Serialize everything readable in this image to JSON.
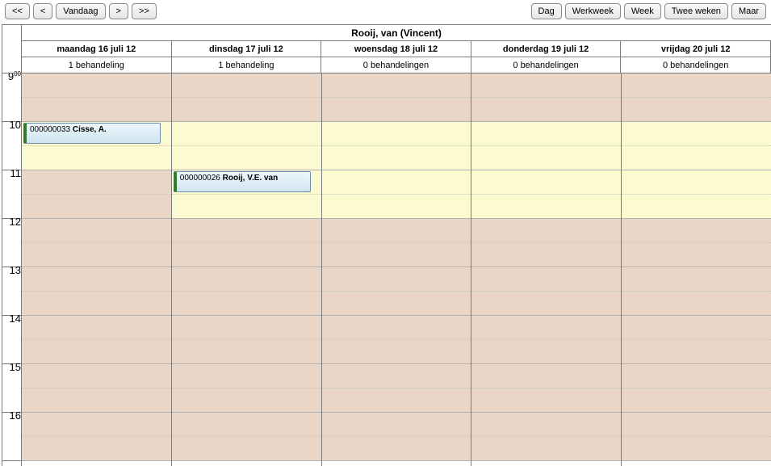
{
  "nav": {
    "first": "<<",
    "prev": "<",
    "today": "Vandaag",
    "next": ">",
    "last": ">>"
  },
  "views": {
    "day": "Dag",
    "workweek": "Werkweek",
    "week": "Week",
    "twoweeks": "Twee weken",
    "month": "Maar"
  },
  "calendar": {
    "owner": "Rooij, van (Vincent)",
    "hour_start": 9,
    "hour_end": 16,
    "minute_label": "00",
    "days": [
      {
        "label": "maandag 16 juli 12",
        "sub": "1 behandeling"
      },
      {
        "label": "dinsdag 17 juli 12",
        "sub": "1 behandeling"
      },
      {
        "label": "woensdag 18 juli 12",
        "sub": "0 behandelingen"
      },
      {
        "label": "donderdag 19 juli 12",
        "sub": "0 behandelingen"
      },
      {
        "label": "vrijdag 20 juli 12",
        "sub": "0 behandelingen"
      }
    ],
    "busy_pattern": [
      [
        true,
        false,
        true,
        true,
        true,
        true,
        true,
        true
      ],
      [
        true,
        false,
        false,
        true,
        true,
        true,
        true,
        true
      ],
      [
        true,
        false,
        false,
        true,
        true,
        true,
        true,
        true
      ],
      [
        true,
        false,
        false,
        true,
        true,
        true,
        true,
        true
      ],
      [
        true,
        false,
        false,
        true,
        true,
        true,
        true,
        true
      ]
    ],
    "appointments": [
      {
        "day": 0,
        "hour_slot": 1,
        "half": 0,
        "duration_halves": 1,
        "code": "000000033",
        "name": "Cisse, A."
      },
      {
        "day": 1,
        "hour_slot": 2,
        "half": 0,
        "duration_halves": 1,
        "code": "000000026",
        "name": "Rooij, V.E. van"
      }
    ]
  }
}
